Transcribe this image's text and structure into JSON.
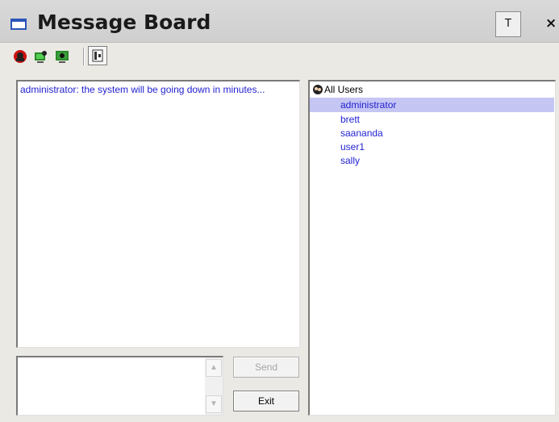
{
  "window": {
    "title": "Message Board",
    "pin_label": "T",
    "close_label": "×"
  },
  "toolbar": {
    "icons": [
      "user-block-icon",
      "user-monitor-icon",
      "monitor-share-icon",
      "mode-toggle-icon"
    ]
  },
  "message_log": {
    "text": "administrator: the system will be going down in  minutes..."
  },
  "users": {
    "root_label": "All Users",
    "items": [
      {
        "label": "administrator",
        "selected": true
      },
      {
        "label": "brett",
        "selected": false
      },
      {
        "label": "saananda",
        "selected": false
      },
      {
        "label": "user1",
        "selected": false
      },
      {
        "label": "sally",
        "selected": false
      }
    ]
  },
  "compose": {
    "value": "",
    "scroll_up": "▲",
    "scroll_down": "▼"
  },
  "buttons": {
    "send_label": "Send",
    "exit_label": "Exit"
  },
  "colors": {
    "message_text": "#1f1fd1",
    "selection": "#c6c6f4",
    "window_bg": "#ebe9e4"
  }
}
